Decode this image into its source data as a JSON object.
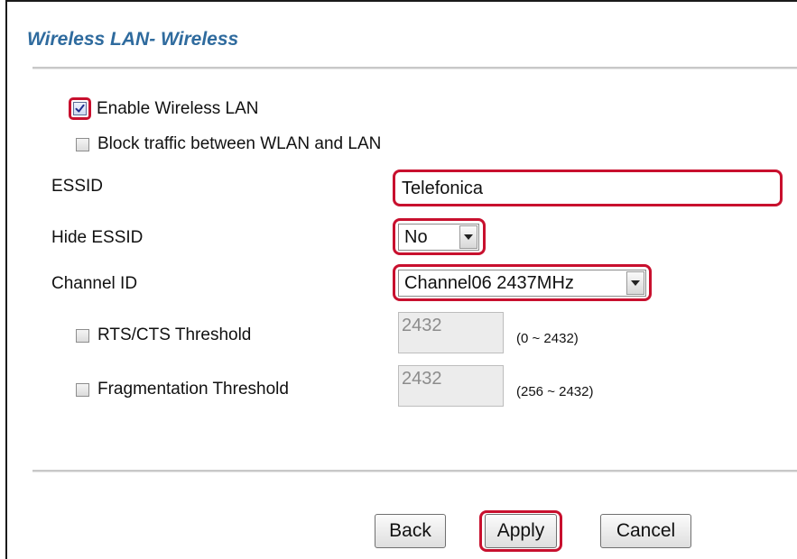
{
  "page": {
    "title": "Wireless LAN- Wireless"
  },
  "options": {
    "enable_wlan": {
      "label": "Enable Wireless LAN",
      "checked": true
    },
    "block_traffic": {
      "label": "Block traffic between WLAN and LAN",
      "checked": false
    }
  },
  "fields": {
    "essid": {
      "label": "ESSID",
      "value": "Telefonica"
    },
    "hide_essid": {
      "label": "Hide ESSID",
      "value": "No"
    },
    "channel_id": {
      "label": "Channel ID",
      "value": "Channel06 2437MHz"
    },
    "rts_cts": {
      "label": "RTS/CTS Threshold",
      "checked": false,
      "value": "2432",
      "range": "(0 ~ 2432)"
    },
    "fragmentation": {
      "label": "Fragmentation Threshold",
      "checked": false,
      "value": "2432",
      "range": "(256 ~ 2432)"
    }
  },
  "buttons": {
    "back": "Back",
    "apply": "Apply",
    "cancel": "Cancel"
  },
  "colors": {
    "title": "#2f6b9e",
    "highlight": "#c8102e",
    "disabled_input_bg": "#ececec",
    "disabled_input_text": "#8c8c8c"
  },
  "icons": {
    "checkbox_checked": "checkmark-icon",
    "dropdown": "chevron-down-icon"
  }
}
